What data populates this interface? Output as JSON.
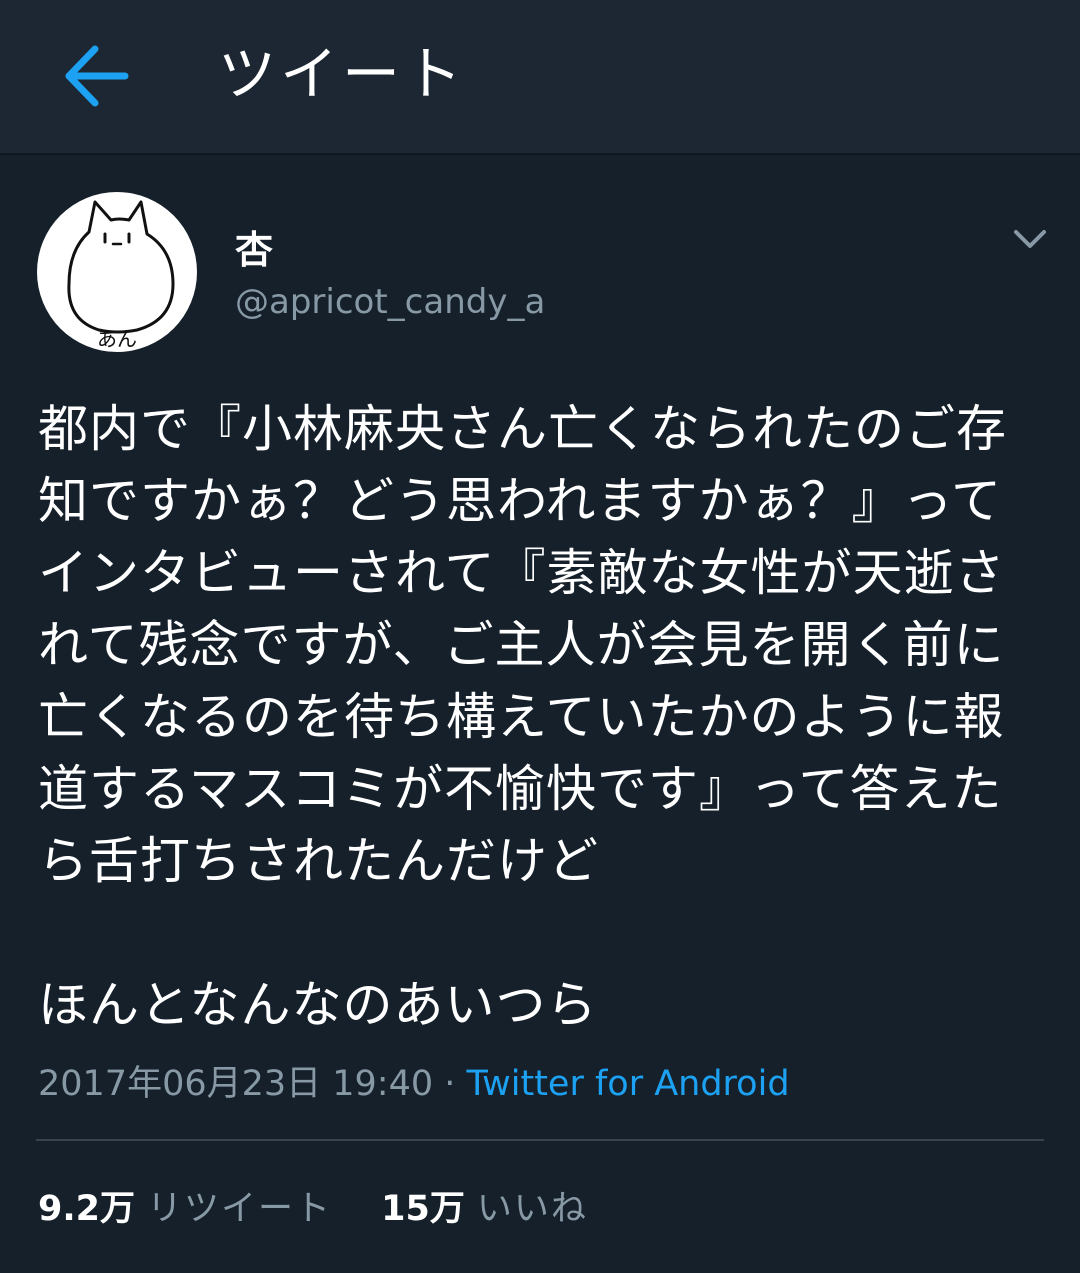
{
  "header": {
    "back_icon": "arrow-left-icon",
    "title": "ツイート",
    "accent_color": "#1da1f2"
  },
  "tweet": {
    "author": {
      "display_name": "杏",
      "handle": "@apricot_candy_a",
      "avatar_caption": "あん"
    },
    "menu_icon": "chevron-down-icon",
    "text": "都内で『小林麻央さん亡くなられたのご存知ですかぁ？どう思われますかぁ？』ってインタビューされて『素敵な女性が天逝されて残念ですが、ご主人が会見を開く前に亡くなるのを待ち構えていたかのように報道するマスコミが不愉快です』って答えたら舌打ちされたんだけど\n\nほんとなんなのあいつら",
    "timestamp": "2017年06月23日 19:40",
    "separator": " · ",
    "source": "Twitter for Android"
  },
  "stats": {
    "retweets_count": "9.2万",
    "retweets_label": "リツイート",
    "likes_count": "15万",
    "likes_label": "いいね"
  },
  "colors": {
    "background": "#15202b",
    "header_background": "#1c2733",
    "secondary_text": "#8899a6",
    "link": "#1da1f2",
    "divider": "#38444d"
  }
}
